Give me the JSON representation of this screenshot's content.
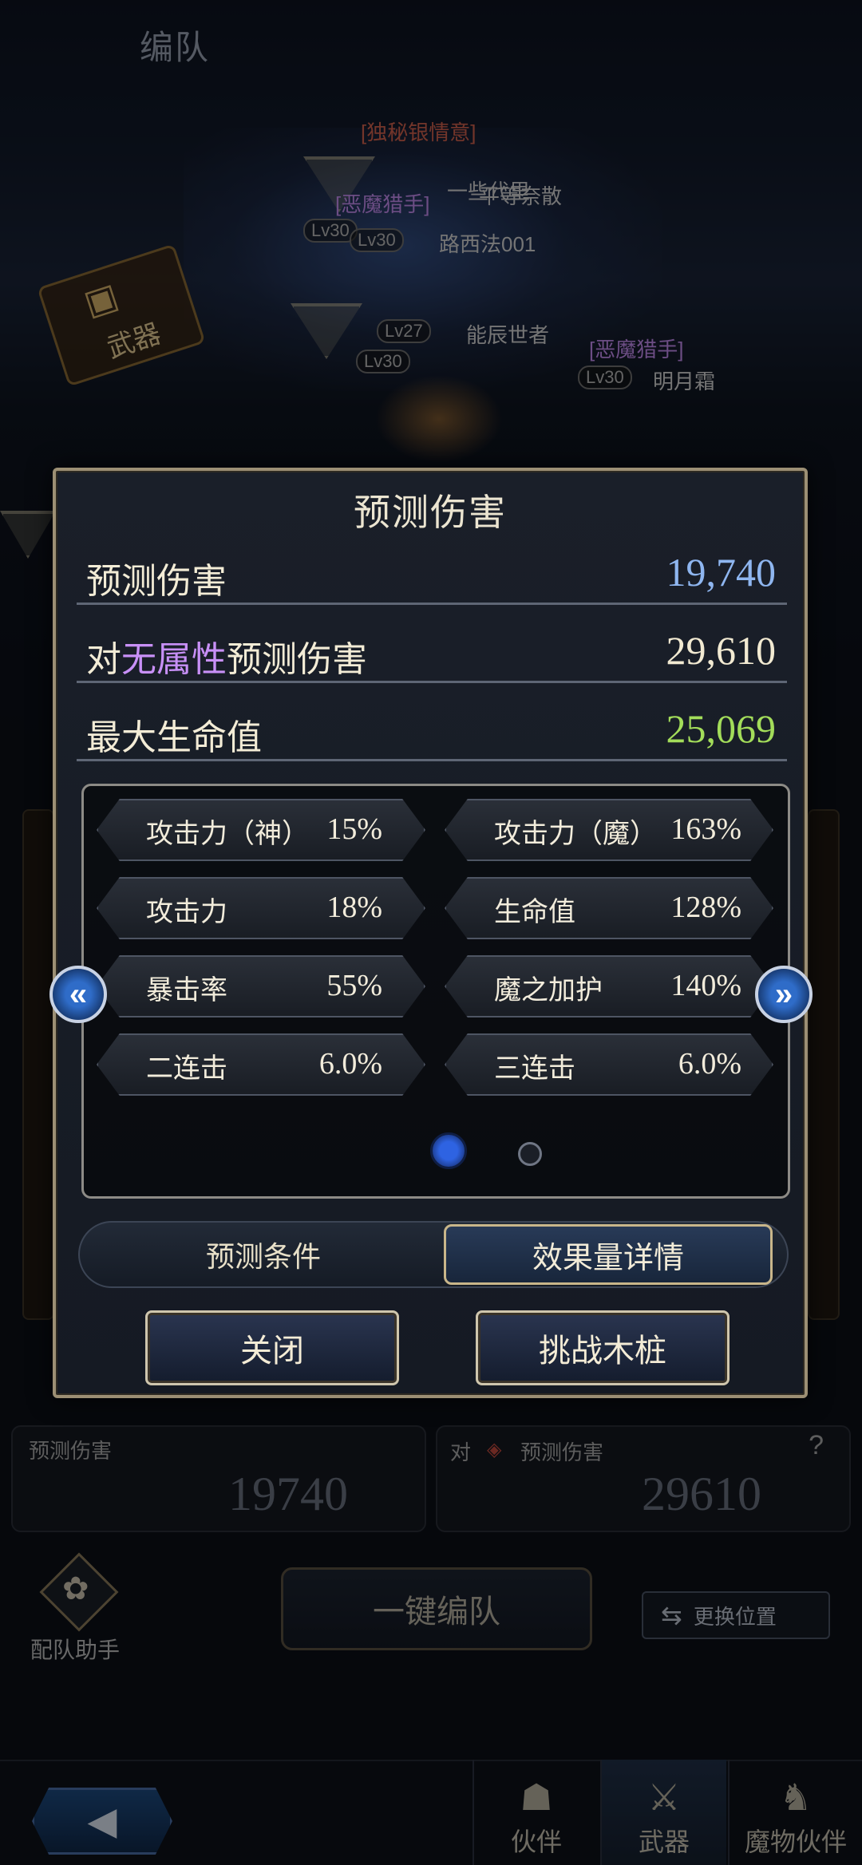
{
  "header": {
    "title": "编队"
  },
  "scene": {
    "weapon_badge": "武器",
    "tags": [
      "[独秘银情意]",
      "[恶魔猎手]",
      "[恶魔猎手]"
    ],
    "levels": [
      "Lv30",
      "Lv30",
      "Lv27",
      "Lv30",
      "Lv30"
    ],
    "names": [
      "一些代里",
      "平等奈散",
      "路西法001",
      "能辰世者",
      "明月霜"
    ]
  },
  "modal": {
    "title": "预测伤害",
    "rows": [
      {
        "label": "预测伤害",
        "value": "19,740",
        "color": "#8fb6f0"
      },
      {
        "prefix": "对",
        "highlight": "无属性",
        "suffix": "预测伤害",
        "value": "29,610",
        "color": "#f2ead2",
        "highlight_color": "#c890f7"
      },
      {
        "label": "最大生命值",
        "value": "25,069",
        "color": "#a3dd5a"
      }
    ],
    "bonuses": [
      {
        "label": "攻击力（神）",
        "value": "15%"
      },
      {
        "label": "攻击力（魔）",
        "value": "163%"
      },
      {
        "label": "攻击力",
        "value": "18%"
      },
      {
        "label": "生命值",
        "value": "128%"
      },
      {
        "label": "暴击率",
        "value": "55%"
      },
      {
        "label": "魔之加护",
        "value": "140%"
      },
      {
        "label": "二连击",
        "value": "6.0%"
      },
      {
        "label": "三连击",
        "value": "6.0%"
      }
    ],
    "arrows": {
      "prev": "«",
      "next": "»"
    },
    "pager": {
      "current": 1,
      "total": 2
    },
    "tabs": {
      "left": "预测条件",
      "right": "效果量详情",
      "active": "right"
    },
    "buttons": {
      "close": "关闭",
      "challenge": "挑战木桩"
    }
  },
  "bottom": {
    "predict_label": "预测伤害",
    "predict_value": "19740",
    "vs_prefix": "对",
    "vs_label": "预测伤害",
    "vs_value": "29610",
    "help": "?",
    "onekey": "一键编队",
    "assist": "配队助手",
    "swap": "更换位置"
  },
  "nav": {
    "tabs": [
      {
        "label": "伙伴",
        "icon": "partner-icon"
      },
      {
        "label": "武器",
        "icon": "weapon-icon"
      },
      {
        "label": "魔物伙伴",
        "icon": "monster-icon"
      }
    ],
    "active": "武器"
  },
  "colors": {
    "accent_blue": "#2e63e2",
    "gold_border": "#9c8f74",
    "purple": "#c890f7",
    "green": "#a3dd5a"
  }
}
